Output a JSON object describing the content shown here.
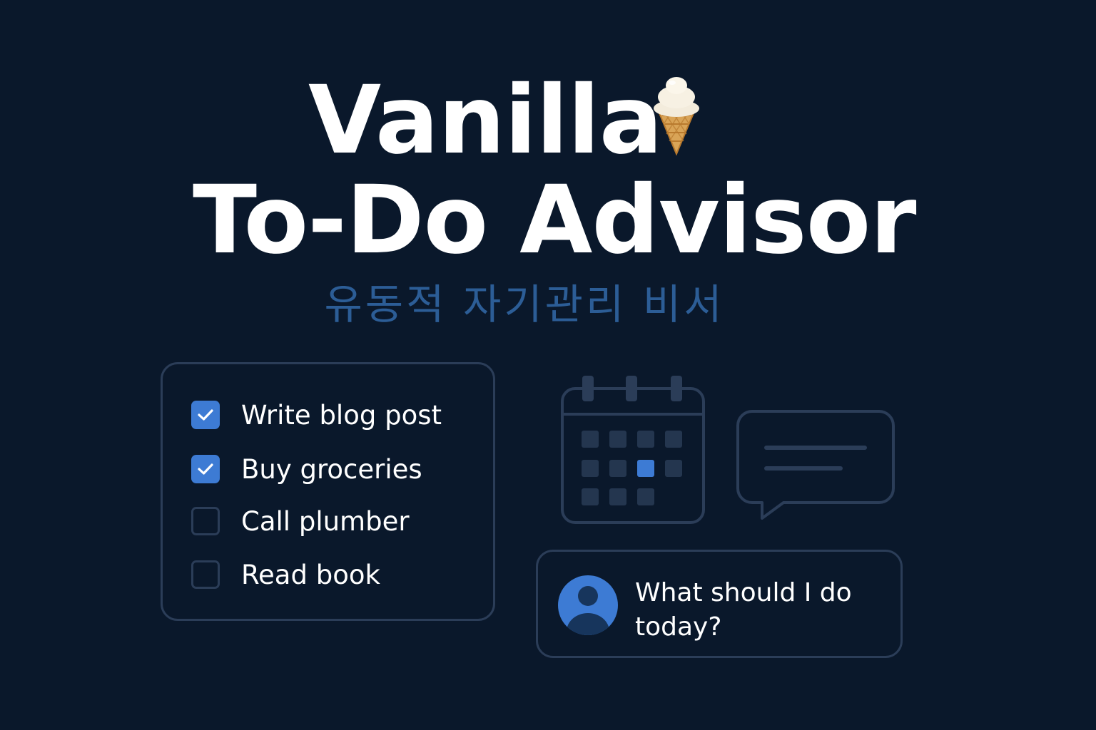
{
  "app": {
    "title_line_1": "Vanilla",
    "title_line_2": "To-Do Advisor",
    "title_icon": "ice-cream-icon",
    "subtitle": "유동적 자기관리 비서"
  },
  "todo_list": {
    "items": [
      {
        "label": "Write blog post",
        "checked": true
      },
      {
        "label": "Buy groceries",
        "checked": true
      },
      {
        "label": "Call plumber",
        "checked": false
      },
      {
        "label": "Read book",
        "checked": false
      }
    ]
  },
  "widgets": {
    "calendar_icon": "calendar-icon",
    "chat_icon": "chat-bubble-icon"
  },
  "assistant": {
    "avatar_icon": "user-avatar-icon",
    "prompt": "What should I do today?"
  },
  "colors": {
    "background": "#0a182b",
    "accent": "#3d7bd4",
    "border": "#2b3d58",
    "subtitle": "#2c5d96",
    "text": "#ffffff"
  }
}
